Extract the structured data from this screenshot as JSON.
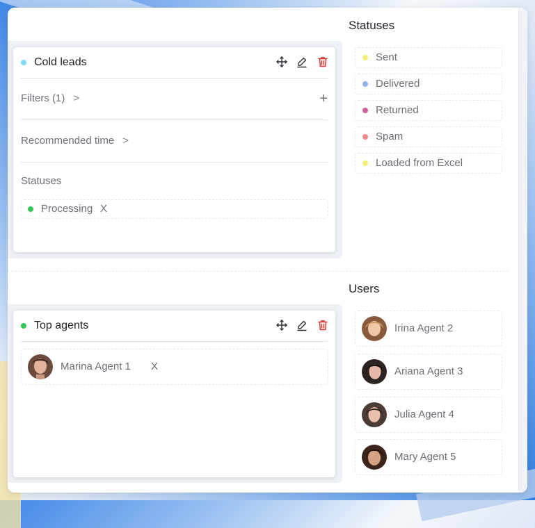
{
  "statuses_panel": {
    "title": "Statuses",
    "items": [
      {
        "label": "Sent",
        "color": "#f5ec7a"
      },
      {
        "label": "Delivered",
        "color": "#8fb4e8"
      },
      {
        "label": "Returned",
        "color": "#d1609f"
      },
      {
        "label": "Spam",
        "color": "#ee8a8a"
      },
      {
        "label": "Loaded from Excel",
        "color": "#f5ec7a"
      }
    ]
  },
  "cold_leads_card": {
    "title": "Cold leads",
    "dot_color": "#7fdcf4",
    "filters_label": "Filters (1)",
    "recommended_time_label": "Recommended time",
    "statuses_label": "Statuses",
    "chevron": ">",
    "plus": "+",
    "selected_status": {
      "label": "Processing",
      "color": "#34c759"
    },
    "remove_glyph": "X"
  },
  "users_panel": {
    "title": "Users",
    "items": [
      {
        "name": "Irina Agent 2",
        "avatar": "avatar-photo"
      },
      {
        "name": "Ariana Agent 3",
        "avatar": "avatar-photo"
      },
      {
        "name": "Julia Agent 4",
        "avatar": "avatar-photo"
      },
      {
        "name": "Mary Agent 5",
        "avatar": "avatar-photo"
      }
    ]
  },
  "top_agents_card": {
    "title": "Top agents",
    "dot_color": "#34c759",
    "selected_user": {
      "name": "Marina Agent 1",
      "avatar": "avatar-photo"
    },
    "remove_glyph": "X"
  },
  "icons": {
    "move": "move-icon",
    "edit": "pencil-icon",
    "delete": "trash-icon",
    "delete_color": "#e0342d"
  }
}
